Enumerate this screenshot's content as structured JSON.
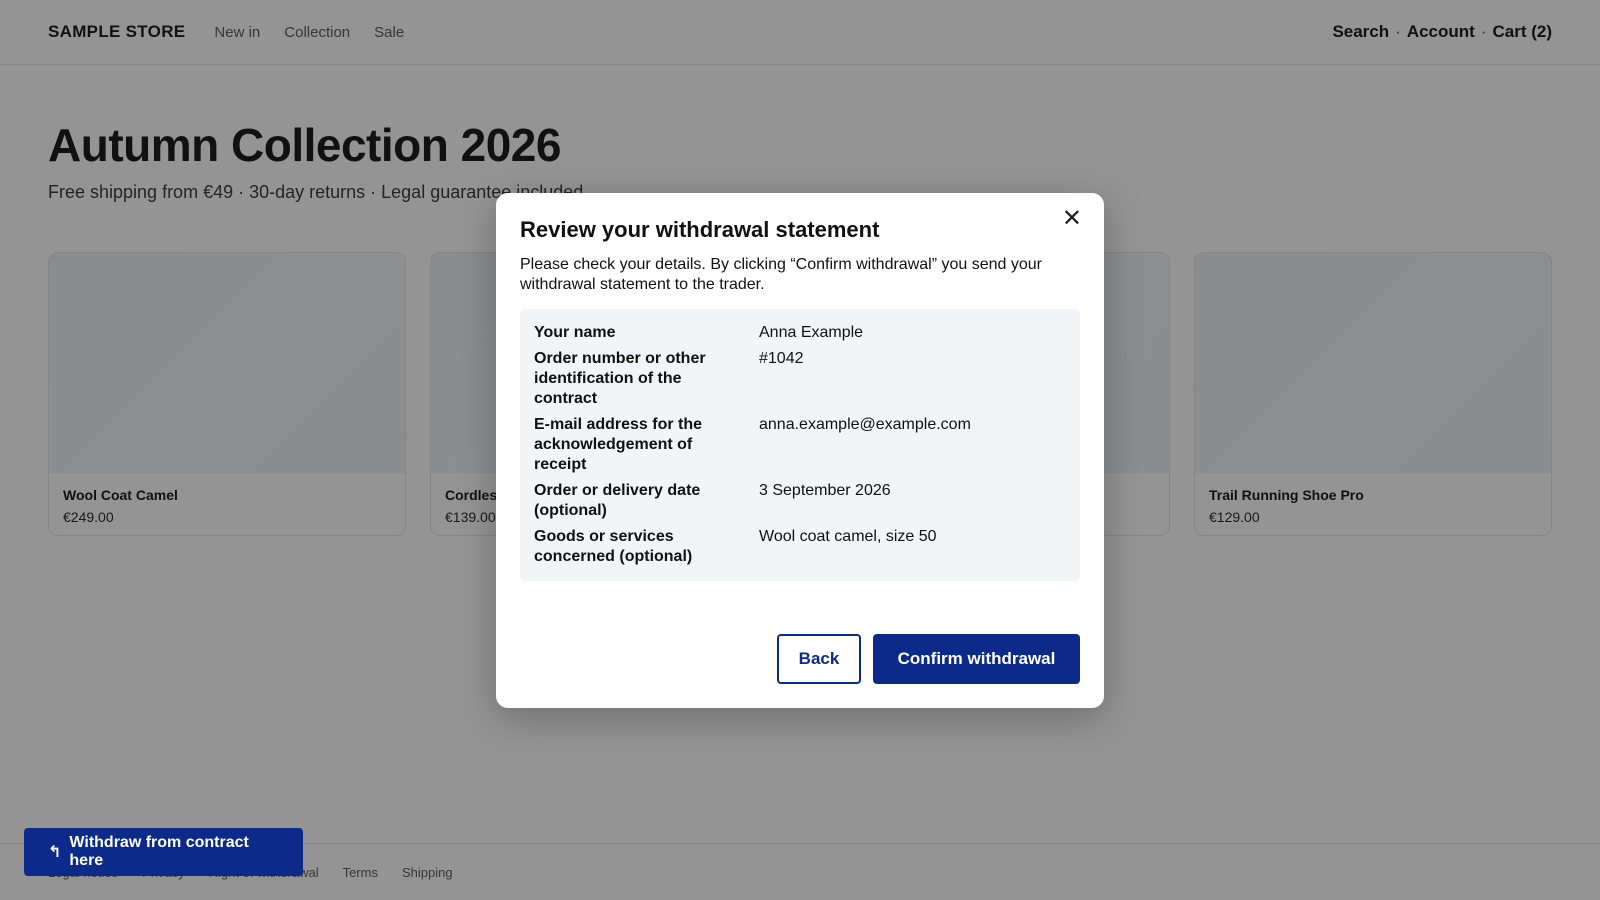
{
  "header": {
    "brand": "SAMPLE STORE",
    "nav": [
      "New in",
      "Collection",
      "Sale"
    ],
    "search": "Search",
    "account": "Account",
    "cart": "Cart (2)",
    "separator": "·"
  },
  "hero": {
    "title": "Autumn Collection 2026",
    "subtitle": "Free shipping from €49 · 30-day returns · Legal guarantee included"
  },
  "products": [
    {
      "name": "Wool Coat Camel",
      "price": "€249.00"
    },
    {
      "name": "Cordless",
      "price": "€139.00"
    },
    {
      "name": "",
      "price": ""
    },
    {
      "name": "Trail Running Shoe Pro",
      "price": "€129.00"
    }
  ],
  "footer": {
    "links": [
      "Legal notice",
      "Privacy",
      "Right of withdrawal",
      "Terms",
      "Shipping"
    ]
  },
  "withdraw_button": {
    "icon": "return-arrow-icon",
    "icon_glyph": "↰",
    "label": "Withdraw from contract here"
  },
  "modal": {
    "title": "Review your withdrawal statement",
    "close_glyph": "✕",
    "description": "Please check your details. By clicking “Confirm withdrawal” you send your withdrawal statement to the trader.",
    "details": [
      {
        "label": "Your name",
        "value": "Anna Example"
      },
      {
        "label": "Order number or other identification of the contract",
        "value": "#1042"
      },
      {
        "label": "E-mail address for the acknowledgement of receipt",
        "value": "anna.example@example.com"
      },
      {
        "label": "Order or delivery date (optional)",
        "value": "3 September 2026"
      },
      {
        "label": "Goods or services concerned (optional)",
        "value": "Wool coat camel, size 50"
      }
    ],
    "back_label": "Back",
    "confirm_label": "Confirm withdrawal"
  },
  "colors": {
    "accent": "#0b2a8a",
    "overlay": "rgba(17,17,17,0.45)"
  }
}
